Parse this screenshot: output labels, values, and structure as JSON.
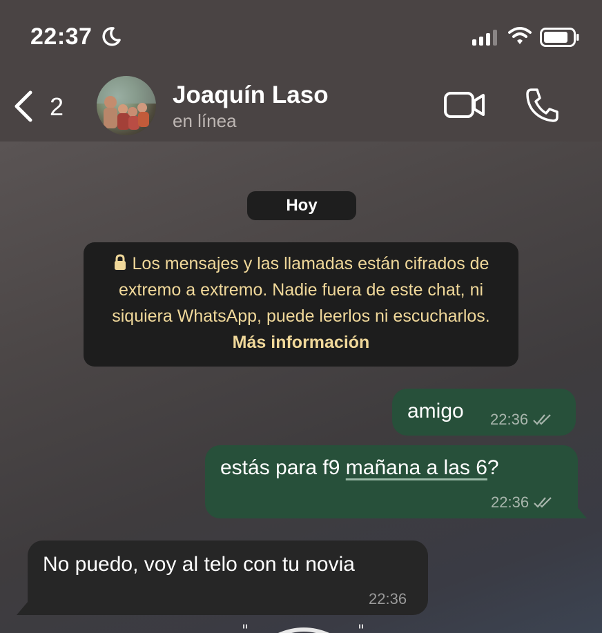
{
  "status_bar": {
    "time": "22:37"
  },
  "header": {
    "back_count": "2",
    "contact_name": "Joaquín Laso",
    "contact_status": "en línea"
  },
  "chat": {
    "date_pill": "Hoy",
    "encryption_notice": {
      "text": "Los mensajes y las llamadas están cifrados de extremo a extremo. Nadie fuera de este chat, ni siquiera WhatsApp, puede leerlos ni escucharlos.",
      "link": "Más información"
    },
    "messages": [
      {
        "direction": "outgoing",
        "text": "amigo",
        "time": "22:36",
        "status": "read"
      },
      {
        "direction": "outgoing",
        "text": "estás para f9 ",
        "link_text": "mañana a las 6",
        "text_after": "?",
        "time": "22:36",
        "status": "read"
      },
      {
        "direction": "incoming",
        "text": "No puedo, voy al telo con tu novia",
        "time": "22:36"
      }
    ]
  },
  "colors": {
    "outgoing_bubble": "#27503a",
    "incoming_bubble": "#262626",
    "notice_text": "#f0d89a"
  }
}
